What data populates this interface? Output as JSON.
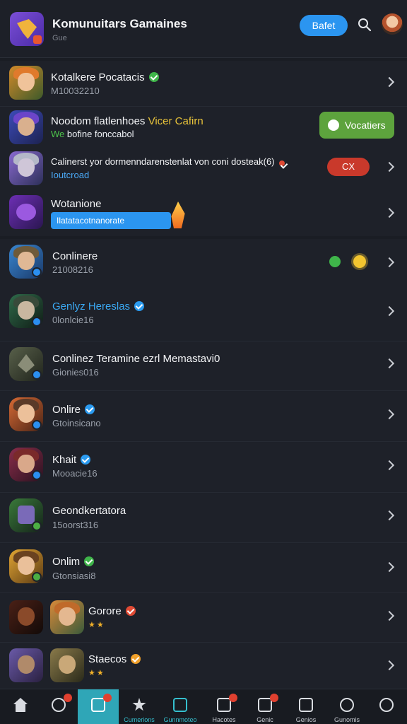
{
  "header": {
    "title": "Komunuitars Gamaines",
    "subtitle": "Gue",
    "button_label": "Bafet"
  },
  "section_one": [
    {
      "title": "Kotalkere Pocatacis",
      "sub": "M10032210"
    },
    {
      "title_a": "Noodom flatlenhoes",
      "title_b": "Vicer Cafirn",
      "sub_a": "We",
      "sub_b": "bofine fonccabol",
      "action_label": "Vocatiers"
    },
    {
      "title": "Calinerst yor dormenndarenstenlat von coni dosteak(6)",
      "sub": "Ioutcroad",
      "action_label": "CX"
    },
    {
      "title": "Wotanione",
      "pill_label": "Ilatatacotnanorate"
    }
  ],
  "list": [
    {
      "title": "Conlinere",
      "sub": "21008216"
    },
    {
      "title": "Genlyz Hereslas",
      "sub": "0lonlcie16"
    },
    {
      "title": "Conlinez Teramine ezrl Memastavi0",
      "sub": "Gionies016"
    },
    {
      "title": "Onlire",
      "sub": "Gtoinsicano"
    },
    {
      "title": "Khait",
      "sub": "Mooacie16"
    },
    {
      "title": "Geondkertatora",
      "sub": "15oorst316"
    },
    {
      "title": "Onlim",
      "sub": "Gtonsiasi8"
    },
    {
      "title": "Gorore",
      "sub": "★★"
    },
    {
      "title": "Staecos",
      "sub": "★★"
    }
  ],
  "nav": [
    {
      "label": ""
    },
    {
      "label": ""
    },
    {
      "label": ""
    },
    {
      "label": "Cumerions"
    },
    {
      "label": "Gunnmoteo"
    },
    {
      "label": "Hacotes"
    },
    {
      "label": "Genic"
    },
    {
      "label": "Genios"
    },
    {
      "label": "Gunomis"
    },
    {
      "label": ""
    }
  ],
  "colors": {
    "accent_blue": "#2b95f0",
    "accent_green": "#5da33d",
    "accent_red": "#c9392b",
    "nav_active": "#2fa6b7"
  }
}
